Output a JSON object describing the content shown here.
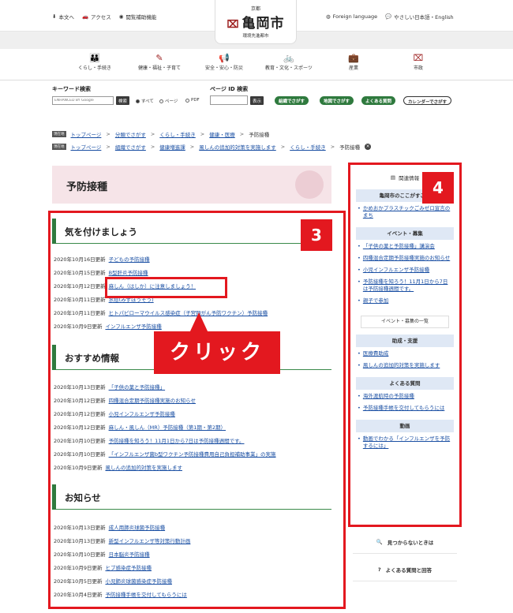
{
  "topbar": {
    "left": [
      "本文へ",
      "アクセス",
      "閲覧補助機能"
    ],
    "right": [
      "Foreign language",
      "やさしい日本語・English"
    ]
  },
  "logo": {
    "small": "京都",
    "name": "亀岡市",
    "sub": "環境先進都市"
  },
  "categories": [
    "くらし・手続き",
    "健康・福祉・子育て",
    "安全・安心・防災",
    "教育・文化・スポーツ",
    "産業",
    "市政"
  ],
  "search": {
    "keyword_label": "キーワード検索",
    "google_placeholder": "ENHANCED BY Google",
    "search_btn": "検索",
    "radio": [
      "すべて",
      "ページ",
      "PDF"
    ],
    "pageid_label": "ページ ID 検索",
    "show_btn": "表示",
    "pills": [
      "組織でさがす",
      "地図でさがす",
      "よくある質問",
      "カレンダーでさがす"
    ]
  },
  "breadcrumb1": {
    "tag": "現在地",
    "items": [
      "トップページ",
      "分類でさがす",
      "くらし・手続き",
      "健康・医療"
    ],
    "current": "予防接種"
  },
  "breadcrumb2": {
    "tag": "現在地",
    "items": [
      "トップページ",
      "組織でさがす",
      "健康増進課",
      "風しんの追加的対策を実施します",
      "くらし・手続き"
    ],
    "current": "予防接種"
  },
  "page_title": "予防接種",
  "sections": [
    {
      "title": "気を付けましょう",
      "items": [
        {
          "date": "2020年10月16日更新",
          "text": "子どもの予防接種"
        },
        {
          "date": "2020年10月15日更新",
          "text": "B型肝炎予防接種"
        },
        {
          "date": "2020年10月12日更新",
          "text": "麻しん（はしか）に注意しましょう！"
        },
        {
          "date": "2020年10月11日更新",
          "text": "水痘(みずぼうそう)"
        },
        {
          "date": "2020年10月11日更新",
          "text": "ヒトパピローマウイルス感染症（子宮頸がん予防ワクチン）予防接種"
        },
        {
          "date": "2020年10月9日更新",
          "text": "インフルエンザ予防接種"
        }
      ]
    },
    {
      "title": "おすすめ情報",
      "items": [
        {
          "date": "2020年10月13日更新",
          "text": "「子供の薬と予防接種」"
        },
        {
          "date": "2020年10月12日更新",
          "text": "四種混合定期予防接種実施のお知らせ"
        },
        {
          "date": "2020年10月12日更新",
          "text": "小児インフルエンザ予防接種"
        },
        {
          "date": "2020年10月12日更新",
          "text": "麻しん・風しん（MR）予防接種（第1期・第2期）"
        },
        {
          "date": "2020年10月10日更新",
          "text": "予防接種を知ろう！11月1日から7日は予防接種週間です。"
        },
        {
          "date": "2020年10月10日更新",
          "text": "「インフルエンザ菌b型ワクチン予防接種費用自己負担補助事業」の実施"
        },
        {
          "date": "2020年10月9日更新",
          "text": "風しんの追加的対策を実施します"
        }
      ]
    },
    {
      "title": "お知らせ",
      "items": [
        {
          "date": "2020年10月13日更新",
          "text": "成人用肺炎球菌予防接種"
        },
        {
          "date": "2020年10月13日更新",
          "text": "新型インフルエンザ等対策行動計画"
        },
        {
          "date": "2020年10月10日更新",
          "text": "日本脳炎予防接種"
        },
        {
          "date": "2020年10月9日更新",
          "text": "ヒブ感染症予防接種"
        },
        {
          "date": "2020年10月5日更新",
          "text": "小児肺炎球菌感染症予防接種"
        },
        {
          "date": "2020年10月4日更新",
          "text": "予防接種手帳を交付してもらうには"
        }
      ]
    }
  ],
  "sidebar": {
    "header": "関連情報",
    "box1": "亀岡市のここがすごい",
    "box1_items": [
      "かめおかプラスチックごみゼロ宣言のまち"
    ],
    "box2": "イベント・募集",
    "box2_items": [
      "「子供の薬と予防接種」講演会",
      "四種混合定期予防接種実施のお知らせ",
      "小児インフルエンザ予防接種",
      "予防接種を知ろう！11月1日から7日は予防接種週間です。",
      "親子で参加"
    ],
    "box2_more": "イベント・募集の一覧",
    "box3": "助成・支援",
    "box3_items": [
      "医療費助成",
      "風しんの追加的対策を実施します"
    ],
    "box4": "よくある質問",
    "box4_items": [
      "海外渡航時の予防接種",
      "予防接種手帳を交付してもらうには"
    ],
    "box5": "動画",
    "box5_items": [
      "動画でわかる「インフルエンザを予防するには」"
    ],
    "btn_notfound": "見つからないときは",
    "btn_faq": "よくある質問と回答"
  },
  "annotations": {
    "badge3": "3",
    "badge4": "4",
    "callout": "クリック"
  },
  "colors": {
    "accent_green": "#2f7a3e",
    "annotation_red": "#e3181f",
    "link_blue": "#1a4fa3"
  }
}
